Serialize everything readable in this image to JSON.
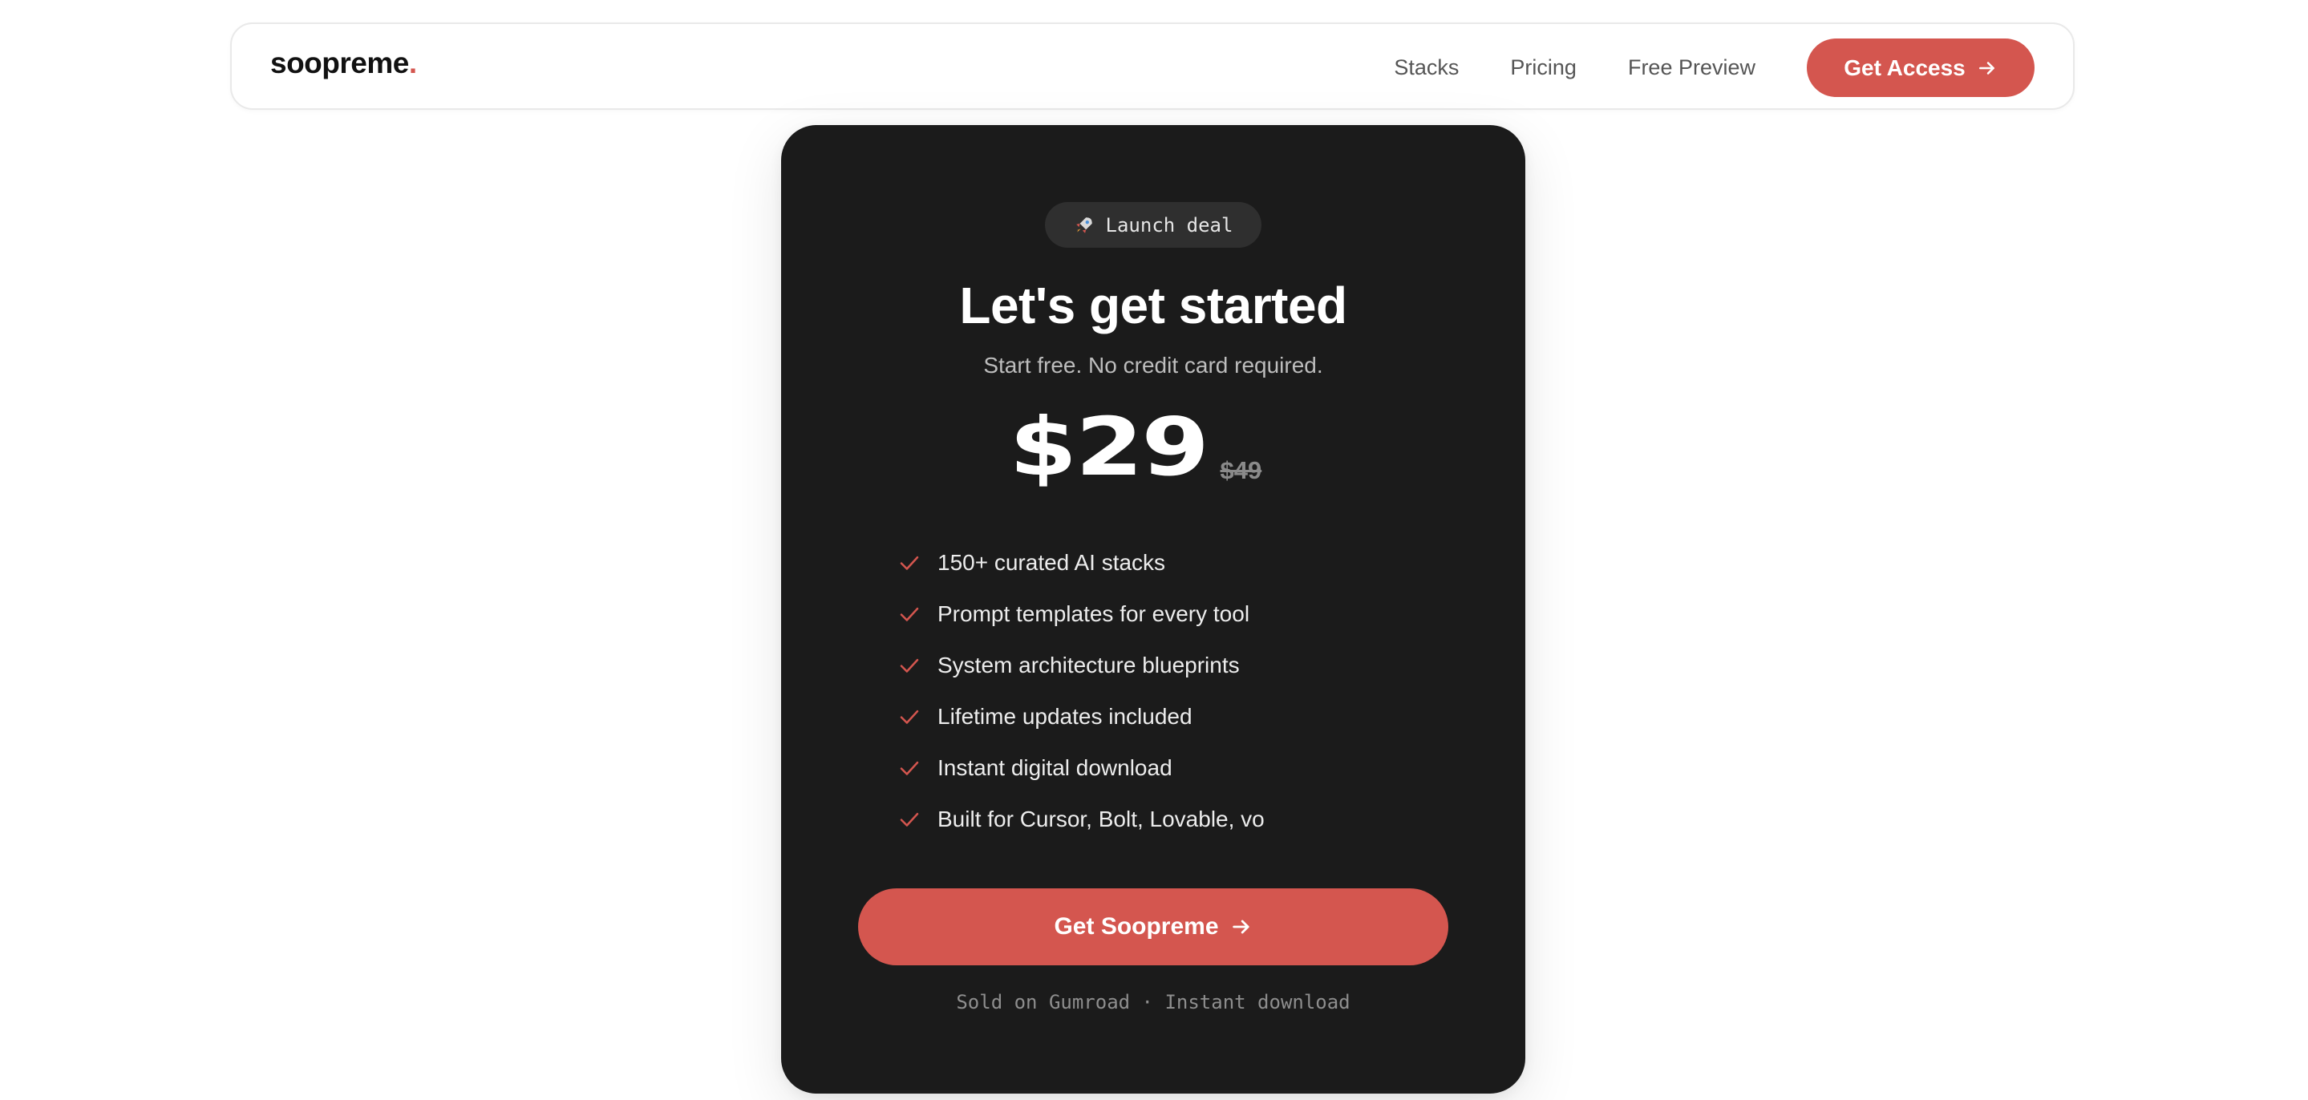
{
  "colors": {
    "accent": "#d4564f",
    "card_background": "#1b1b1b",
    "page_background": "#ffffff"
  },
  "nav": {
    "logo_text": "soopreme",
    "logo_dot": ".",
    "links": [
      {
        "label": "Stacks"
      },
      {
        "label": "Pricing"
      },
      {
        "label": "Free Preview"
      }
    ],
    "cta_label": "Get Access",
    "cta_icon": "arrow-right-icon"
  },
  "card": {
    "badge_icon": "rocket-icon",
    "badge_label": "Launch deal",
    "title": "Let's get started",
    "subtitle": "Start free. No credit card required.",
    "price": "$29",
    "old_price": "$49",
    "features": [
      {
        "text": "150+ curated AI stacks",
        "icon": "check-icon"
      },
      {
        "text": "Prompt templates for every tool",
        "icon": "check-icon"
      },
      {
        "text": "System architecture blueprints",
        "icon": "check-icon"
      },
      {
        "text": "Lifetime updates included",
        "icon": "check-icon"
      },
      {
        "text": "Instant digital download",
        "icon": "check-icon"
      },
      {
        "text": "Built for Cursor, Bolt, Lovable, vo",
        "icon": "check-icon"
      }
    ],
    "cta_label": "Get Soopreme",
    "cta_icon": "arrow-right-icon",
    "footnote": "Sold on Gumroad · Instant download"
  }
}
